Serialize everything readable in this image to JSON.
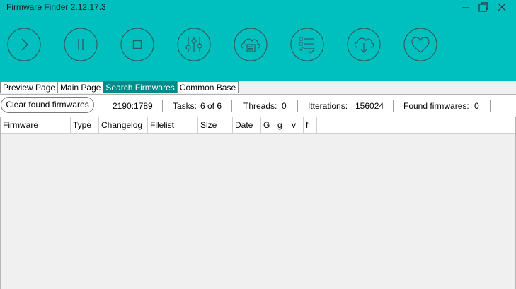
{
  "window": {
    "title": "Firmware Finder 2.12.17.3",
    "accent_color": "#00bfbf",
    "active_tab_color": "#008b8b",
    "controls": [
      "minimize-icon",
      "restore-icon",
      "close-icon"
    ]
  },
  "toolbar": {
    "buttons": [
      {
        "name": "play-icon"
      },
      {
        "name": "pause-icon"
      },
      {
        "name": "stop-icon"
      },
      {
        "name": "sliders-icon"
      },
      {
        "name": "cloud-document-icon"
      },
      {
        "name": "checklist-icon"
      },
      {
        "name": "cloud-download-icon"
      },
      {
        "name": "heart-icon"
      }
    ]
  },
  "tabs": [
    {
      "label": "Preview Page",
      "active": false
    },
    {
      "label": "Main Page",
      "active": false
    },
    {
      "label": "Search Firmwares",
      "active": true
    },
    {
      "label": "Common Base",
      "active": false
    }
  ],
  "status": {
    "clear_button_label": "Clear found firmwares",
    "progress": "2190:1789",
    "tasks_label": "Tasks:",
    "tasks_value": "6 of 6",
    "threads_label": "Threads:",
    "threads_value": "0",
    "iterations_label": "Itterations:",
    "iterations_value": "156024",
    "found_label": "Found firmwares:",
    "found_value": "0"
  },
  "grid": {
    "columns": [
      "Firmware",
      "Type",
      "Changelog",
      "Filelist",
      "Size",
      "Date",
      "G",
      "g",
      "v",
      "f"
    ],
    "rows": []
  }
}
